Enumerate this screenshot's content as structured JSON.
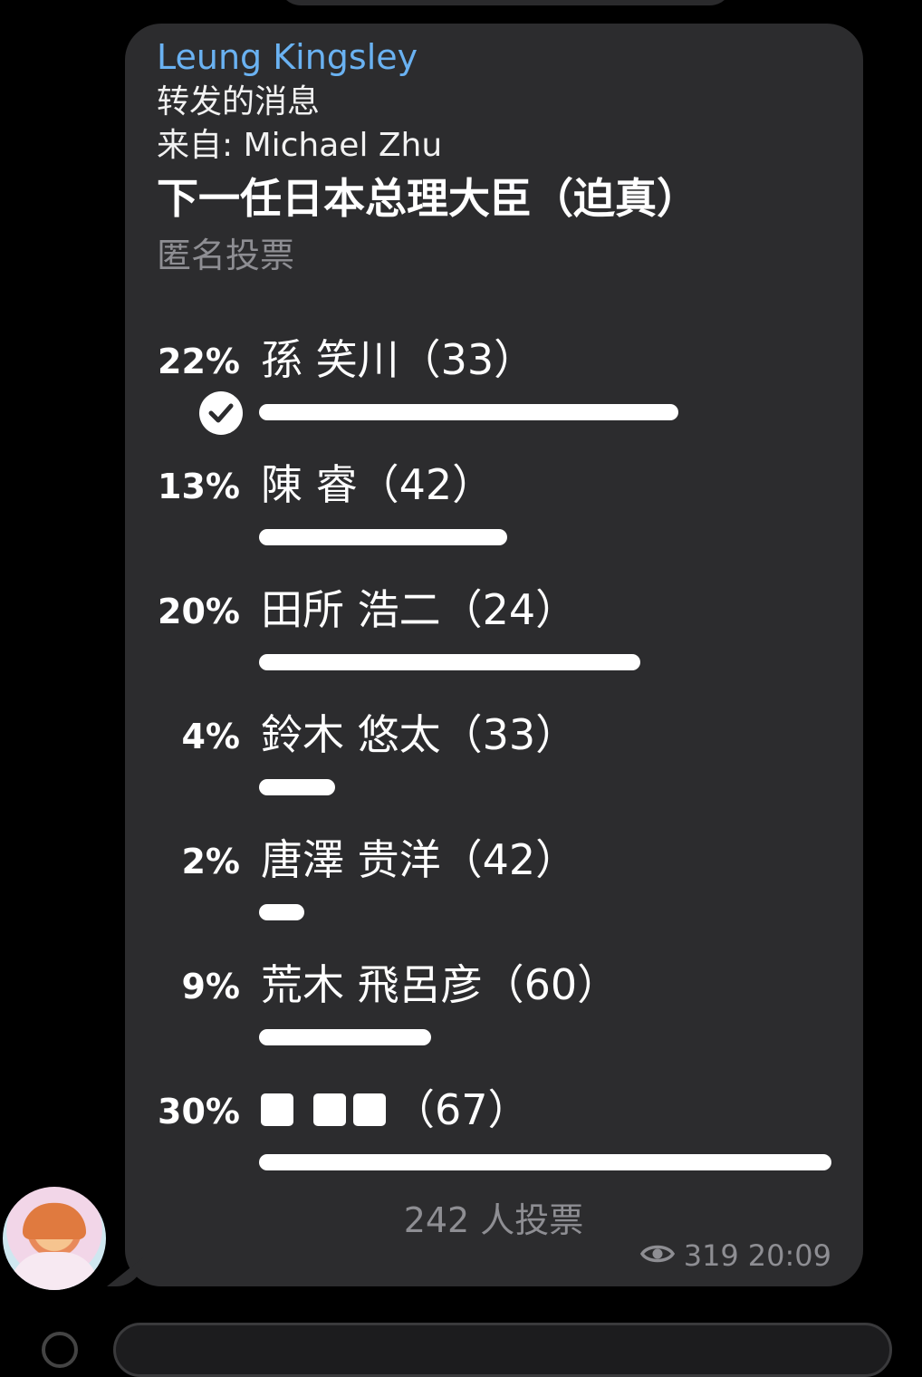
{
  "message": {
    "sender": "Leung Kingsley",
    "forwarded_label": "转发的消息",
    "forwarded_from": "来自: Michael Zhu",
    "views": "319",
    "time": "20:09"
  },
  "poll": {
    "question": "下一任日本总理大臣（迫真）",
    "type": "匿名投票",
    "total_votes": "242 人投票",
    "options": [
      {
        "percent": "22%",
        "label": "孫 笑川（33）",
        "fraction": 0.22,
        "voted": true
      },
      {
        "percent": "13%",
        "label": "陳 睿（42）",
        "fraction": 0.13,
        "voted": false
      },
      {
        "percent": "20%",
        "label": "田所 浩二（24）",
        "fraction": 0.2,
        "voted": false
      },
      {
        "percent": "4%",
        "label": "鈴木 悠太（33）",
        "fraction": 0.04,
        "voted": false
      },
      {
        "percent": "2%",
        "label": "唐澤 贵洋（42）",
        "fraction": 0.02,
        "voted": false
      },
      {
        "percent": "9%",
        "label": "荒木 飛呂彦（60）",
        "fraction": 0.09,
        "voted": false
      },
      {
        "percent": "30%",
        "label": "（67）",
        "fraction": 0.3,
        "voted": false,
        "censored": true
      }
    ]
  },
  "colors": {
    "background": "#000000",
    "bubble": "#2c2c2e",
    "sender": "#6ab2f2",
    "muted": "#8e8e93",
    "bar": "#ffffff"
  },
  "icons": {
    "check": "check-icon",
    "views": "eye-icon"
  }
}
